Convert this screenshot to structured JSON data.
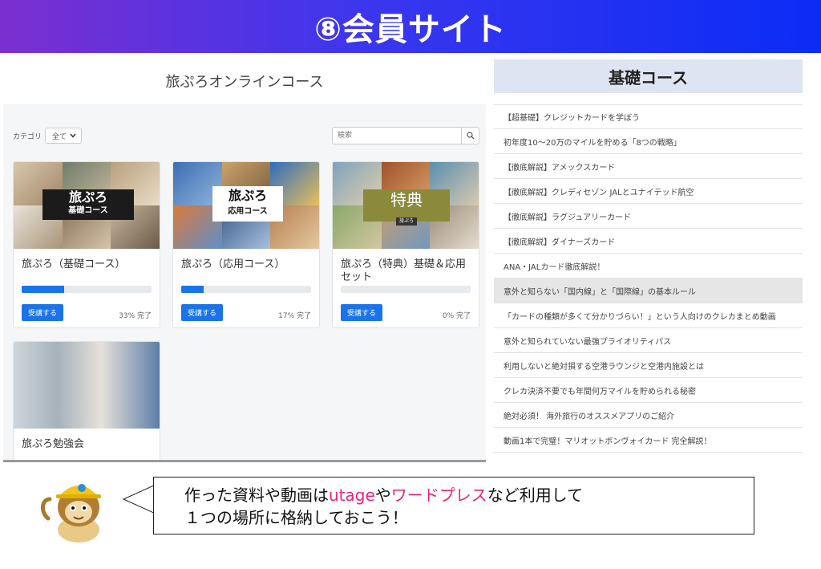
{
  "slide": {
    "title": "⑧会員サイト"
  },
  "course_page": {
    "title": "旅ぷろオンラインコース",
    "filter": {
      "label": "カテゴリ",
      "selected": "全て"
    },
    "search": {
      "placeholder": "検索"
    },
    "cards": [
      {
        "title": "旅ぷろ（基礎コース）",
        "thumb_big": "旅ぷろ",
        "thumb_small": "基礎コース",
        "button": "受講する",
        "progress": 0.33,
        "progress_label": "33% 完了"
      },
      {
        "title": "旅ぷろ（応用コース）",
        "thumb_big": "旅ぷろ",
        "thumb_small": "応用コース",
        "button": "受講する",
        "progress": 0.17,
        "progress_label": "17% 完了"
      },
      {
        "title": "旅ぷろ（特典）基礎＆応用セット",
        "thumb_big": "特典",
        "thumb_small": "旅ぷろ",
        "button": "受講する",
        "progress": 0.0,
        "progress_label": "0% 完了"
      },
      {
        "title": "旅ぷろ勉強会"
      }
    ]
  },
  "lesson_panel": {
    "title": "基礎コース",
    "items": [
      "【超基礎】クレジットカードを学ぼう",
      "初年度10～20万のマイルを貯める「8つの戦略」",
      "【徹底解説】アメックスカード",
      "【徹底解説】クレディセゾン JALとユナイテッド航空",
      "【徹底解説】ラグジュアリーカード",
      "【徹底解説】ダイナーズカード",
      "ANA・JALカード徹底解説！",
      "意外と知らない「国内線」と「国際線」の基本ルール",
      "「カードの種類が多くて分かりづらい！」という人向けのクレカまとめ動画",
      "意外と知られていない最強プライオリティパス",
      "利用しないと絶対損する空港ラウンジと空港内施設とは",
      "クレカ決済不要でも年間何万マイルを貯められる秘密",
      "絶対必須！ 海外旅行のオススメアプリのご紹介",
      "動画1本で完璧！マリオットボンヴォイカード 完全解説！"
    ],
    "active_index": 7
  },
  "speech": {
    "line1_a": "作った資料や動画は",
    "line1_b": "utage",
    "line1_c": "や",
    "line1_d": "ワードプレス",
    "line1_e": "など利用して",
    "line2": "１つの場所に格納しておこう！"
  },
  "colors": {
    "banner_start": "#7b2fd0",
    "banner_end": "#0a2cf6",
    "accent": "#1a73e8",
    "highlight_text": "#e8257d"
  }
}
